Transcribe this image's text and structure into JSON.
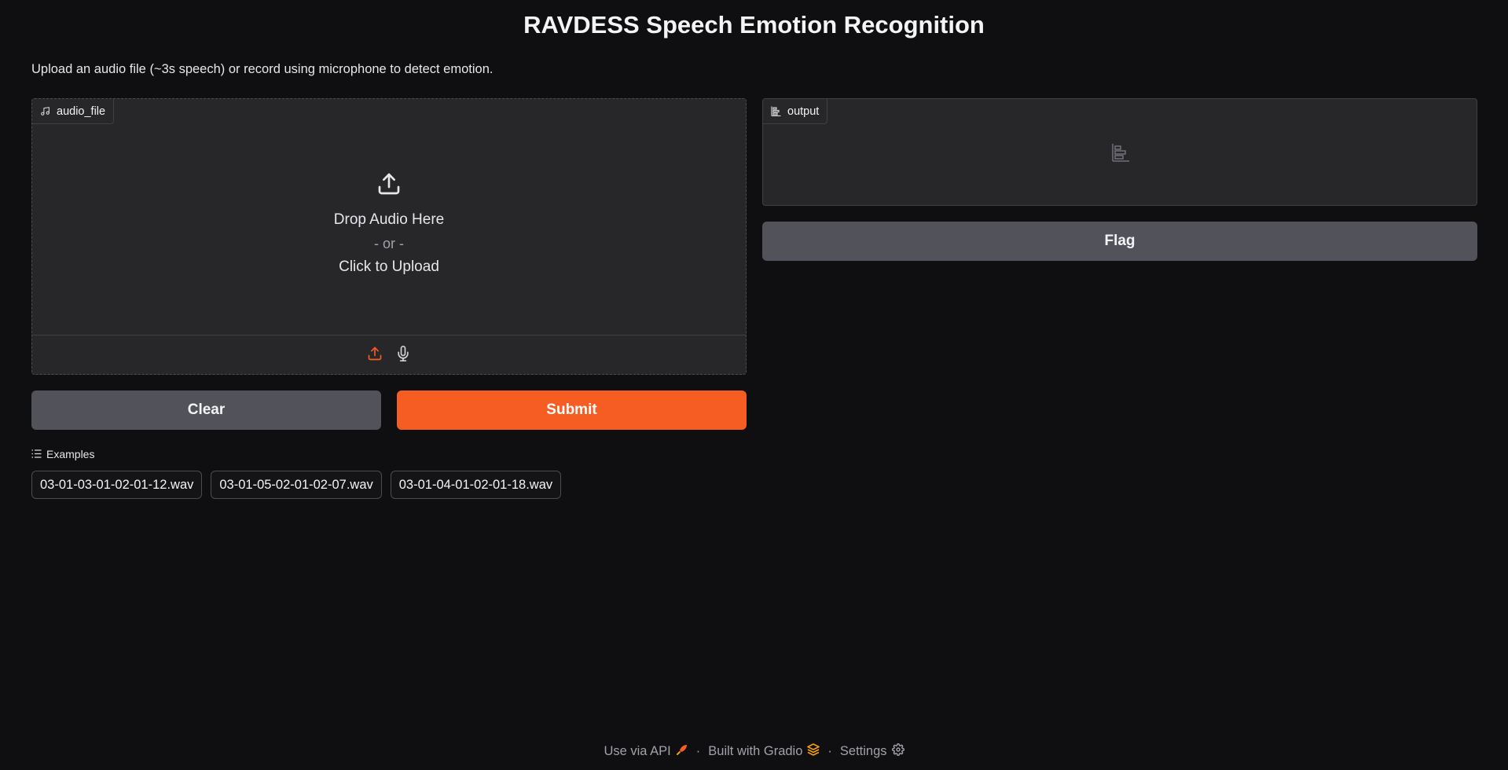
{
  "header": {
    "title": "RAVDESS Speech Emotion Recognition",
    "description": "Upload an audio file (~3s speech) or record using microphone to detect emotion."
  },
  "audio_input": {
    "label": "audio_file",
    "drop_text": "Drop Audio Here",
    "or_text": "- or -",
    "click_text": "Click to Upload",
    "sources": [
      "upload-icon",
      "microphone-icon"
    ],
    "active_source": "upload"
  },
  "buttons": {
    "clear_label": "Clear",
    "submit_label": "Submit",
    "flag_label": "Flag"
  },
  "examples": {
    "label": "Examples",
    "items": [
      "03-01-03-01-02-01-12.wav",
      "03-01-05-02-01-02-07.wav",
      "03-01-04-01-02-01-18.wav"
    ]
  },
  "output": {
    "label": "output"
  },
  "footer": {
    "api_label": "Use via API",
    "built_label": "Built with Gradio",
    "settings_label": "Settings",
    "separator": "·"
  },
  "colors": {
    "background": "#0f0f11",
    "panel": "#27272a",
    "accent": "#f55d22",
    "secondary_button": "#52525b"
  }
}
